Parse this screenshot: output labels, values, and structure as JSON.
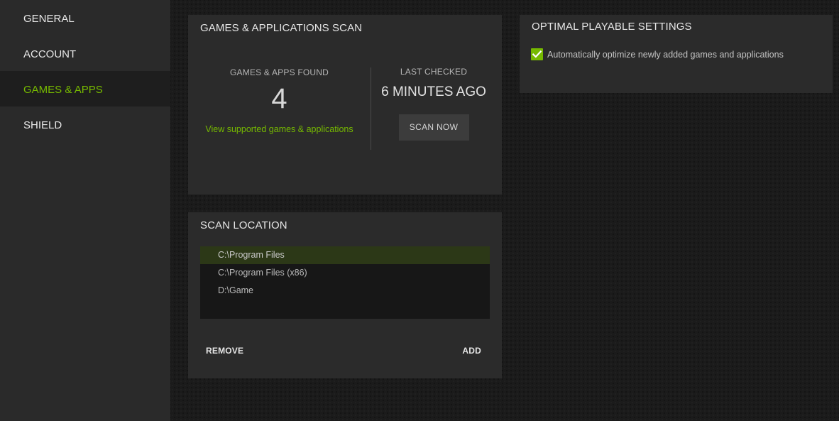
{
  "sidebar": {
    "items": [
      {
        "label": "GENERAL",
        "active": false
      },
      {
        "label": "ACCOUNT",
        "active": false
      },
      {
        "label": "GAMES & APPS",
        "active": true
      },
      {
        "label": "SHIELD",
        "active": false
      }
    ]
  },
  "scan_panel": {
    "title": "GAMES & APPLICATIONS SCAN",
    "found_label": "GAMES & APPS FOUND",
    "found_count": "4",
    "found_link": "View supported games & applications",
    "checked_label": "LAST CHECKED",
    "checked_value": "6 MINUTES AGO",
    "scan_button": "SCAN NOW"
  },
  "location_panel": {
    "title": "SCAN LOCATION",
    "locations": [
      "C:\\Program Files",
      "C:\\Program Files (x86)",
      "D:\\Game"
    ],
    "selected_index": 0,
    "remove_label": "REMOVE",
    "add_label": "ADD"
  },
  "optimal_panel": {
    "title": "OPTIMAL PLAYABLE SETTINGS",
    "checkbox_checked": true,
    "checkbox_label": "Automatically optimize newly added games and applications"
  },
  "colors": {
    "accent": "#76b900",
    "selected_row": "#2c3817"
  },
  "icons": {
    "checkbox": "checkmark-icon"
  }
}
